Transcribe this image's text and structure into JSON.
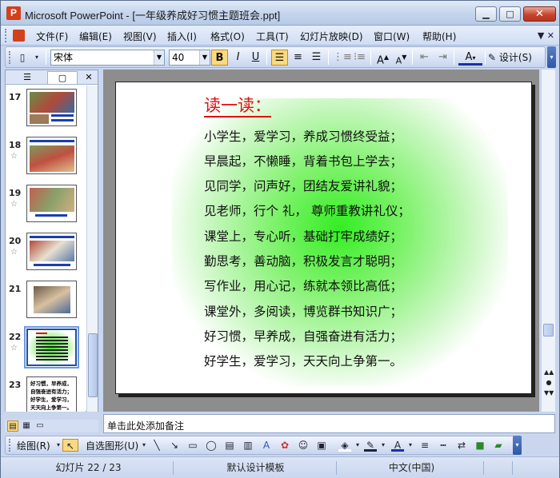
{
  "window": {
    "title": "Microsoft PowerPoint - [一年级养成好习惯主题班会.ppt]",
    "minimize": "▁",
    "maximize": "□",
    "close": "✕"
  },
  "menu": {
    "items": [
      "文件(F)",
      "编辑(E)",
      "视图(V)",
      "插入(I)",
      "格式(O)",
      "工具(T)",
      "幻灯片放映(D)",
      "窗口(W)",
      "帮助(H)"
    ],
    "overflow": "▼ ✕"
  },
  "toolbar": {
    "font_name": "宋体",
    "font_size": "40",
    "bold": "B",
    "italic": "I",
    "underline": "U",
    "design_label": "设计(S)"
  },
  "pane": {
    "tab_outline_icon": "outline-icon",
    "tab_slides_icon": "slides-icon",
    "close": "✕",
    "slides": [
      {
        "num": "17",
        "star": ""
      },
      {
        "num": "18",
        "star": "☆"
      },
      {
        "num": "19",
        "star": "☆"
      },
      {
        "num": "20",
        "star": "☆"
      },
      {
        "num": "21",
        "star": ""
      },
      {
        "num": "22",
        "star": "☆"
      },
      {
        "num": "23",
        "star": ""
      }
    ],
    "thumb23_text": [
      "好习惯，早养成，",
      "自强奋进有活力；",
      "好学生，爱学习，",
      "天天向上争第一。"
    ]
  },
  "slide": {
    "title": "读一读：",
    "lines": [
      "小学生，爱学习，养成习惯终受益；",
      "早晨起，不懒睡，背着书包上学去；",
      "见同学，问声好，团结友爱讲礼貌；",
      "见老师，行个 礼，  尊师重教讲礼仪；",
      "课堂上，专心听，基础打牢成绩好；",
      "勤思考，善动脑，积极发言才聪明；",
      "写作业，用心记，练就本领比高低；",
      "课堂外，多阅读，博览群书知识广；",
      "好习惯，早养成，自强奋进有活力；",
      "好学生，爱学习，天天向上争第一。"
    ],
    "title_color": "#e01010",
    "glow_color": "#33ee22"
  },
  "notes": {
    "placeholder": "单击此处添加备注"
  },
  "drawbar": {
    "draw_label": "绘图(R)",
    "autoshapes_label": "自选图形(U)"
  },
  "status": {
    "slide_info": "幻灯片 22 / 23",
    "template": "默认设计模板",
    "language": "中文(中国)"
  }
}
